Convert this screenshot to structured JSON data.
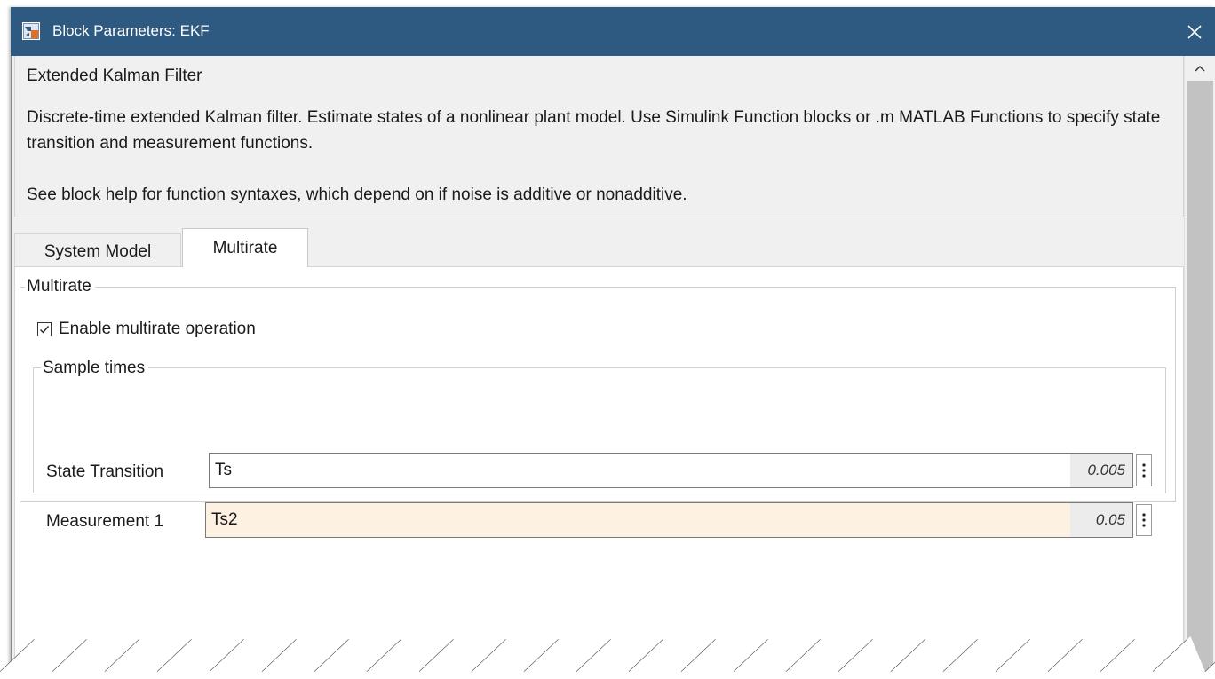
{
  "window": {
    "title": "Block Parameters: EKF"
  },
  "description": {
    "title": "Extended Kalman Filter",
    "line1": "Discrete-time extended Kalman filter. Estimate states of a nonlinear plant model. Use Simulink Function blocks or .m MATLAB Functions to specify state transition and measurement functions.",
    "line2": "See block help for function syntaxes, which depend on if noise is additive or nonadditive."
  },
  "tabs": [
    {
      "label": "System Model",
      "active": false
    },
    {
      "label": "Multirate",
      "active": true
    }
  ],
  "multirate": {
    "group_title": "Multirate",
    "enable_checkbox": {
      "label": "Enable multirate operation",
      "checked": true
    },
    "sample_times": {
      "group_title": "Sample times",
      "state_transition": {
        "label": "State Transition",
        "value": "Ts",
        "hint": "0.005"
      },
      "measurement1": {
        "label": "Measurement 1",
        "value": "Ts2",
        "hint": "0.05"
      }
    }
  },
  "icons": {
    "app": "simulink-block-icon",
    "close": "close-icon",
    "scroll_up": "chevron-up-icon",
    "more": "vertical-ellipsis-icon"
  },
  "colors": {
    "titlebar": "#2e5a82",
    "highlight_field": "#fdf1e1"
  }
}
